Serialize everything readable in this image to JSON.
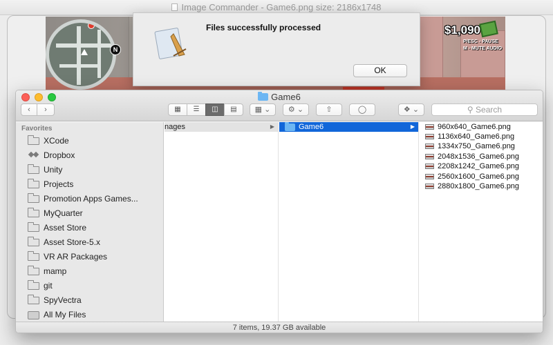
{
  "app_window": {
    "title": "Image Commander - Game6.png size: 2186x1748"
  },
  "game_preview": {
    "money": "$1,090",
    "hud_pause": "P/ESC - PAUSE",
    "hud_mute": "M - MUTE AUDIO",
    "map_north": "N"
  },
  "alert": {
    "message": "Files successfully processed",
    "ok_label": "OK"
  },
  "finder": {
    "title": "Game6",
    "search_placeholder": "Search",
    "sidebar": {
      "heading": "Favorites",
      "items": [
        {
          "label": "XCode",
          "icon": "folder-icon"
        },
        {
          "label": "Dropbox",
          "icon": "dropbox-icon"
        },
        {
          "label": "Unity",
          "icon": "folder-icon"
        },
        {
          "label": "Projects",
          "icon": "folder-icon"
        },
        {
          "label": "Promotion Apps Games...",
          "icon": "folder-icon"
        },
        {
          "label": "MyQuarter",
          "icon": "folder-icon"
        },
        {
          "label": "Asset Store",
          "icon": "folder-icon"
        },
        {
          "label": "Asset Store-5.x",
          "icon": "folder-icon"
        },
        {
          "label": "VR AR Packages",
          "icon": "folder-icon"
        },
        {
          "label": "mamp",
          "icon": "folder-icon"
        },
        {
          "label": "git",
          "icon": "folder-icon"
        },
        {
          "label": "SpyVectra",
          "icon": "folder-icon"
        },
        {
          "label": "All My Files",
          "icon": "all-files-icon"
        }
      ]
    },
    "column1": {
      "items": [
        "nages"
      ]
    },
    "column2": {
      "items": [
        "Game6"
      ]
    },
    "column3": {
      "files": [
        "960x640_Game6.png",
        "1136x640_Game6.png",
        "1334x750_Game6.png",
        "2048x1536_Game6.png",
        "2208x1242_Game6.png",
        "2560x1600_Game6.png",
        "2880x1800_Game6.png"
      ]
    },
    "status": "7 items, 19.37 GB available"
  }
}
